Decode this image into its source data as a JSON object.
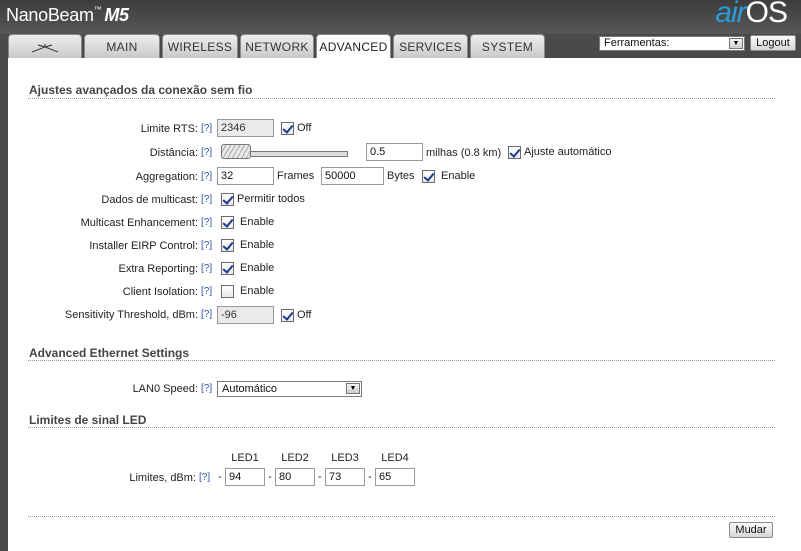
{
  "header": {
    "brand_name": "NanoBeam",
    "brand_tm": "™",
    "brand_model": "M5",
    "logo_air": "air",
    "logo_os": "OS"
  },
  "tabs": [
    {
      "label": "",
      "icon": "ubiquiti-logo-icon"
    },
    {
      "label": "MAIN"
    },
    {
      "label": "WIRELESS"
    },
    {
      "label": "NETWORK"
    },
    {
      "label": "ADVANCED",
      "active": true
    },
    {
      "label": "SERVICES"
    },
    {
      "label": "SYSTEM"
    }
  ],
  "tools": {
    "selected": "Ferramentas:",
    "logout": "Logout"
  },
  "help_label": "[?]",
  "wireless_section": {
    "title": "Ajustes avançados da conexão sem fio",
    "rts": {
      "label": "Limite RTS:",
      "value": "2346",
      "checkbox_label": "Off",
      "checked": true
    },
    "distance": {
      "label": "Distância:",
      "value": "0.5",
      "unit_text": "milhas (0.8 km)",
      "auto_label": "Ajuste automático",
      "auto_checked": true
    },
    "aggregation": {
      "label": "Aggregation:",
      "frames": "32",
      "frames_label": "Frames",
      "bytes": "50000",
      "bytes_label": "Bytes",
      "enable_label": "Enable",
      "checked": true
    },
    "multicast": {
      "label": "Dados de multicast:",
      "checkbox_label": "Permitir todos",
      "checked": true
    },
    "multicast_enh": {
      "label": "Multicast Enhancement:",
      "checkbox_label": "Enable",
      "checked": true
    },
    "eirp": {
      "label": "Installer EIRP Control:",
      "checkbox_label": "Enable",
      "checked": true
    },
    "extra": {
      "label": "Extra Reporting:",
      "checkbox_label": "Enable",
      "checked": true
    },
    "isolation": {
      "label": "Client Isolation:",
      "checkbox_label": "Enable",
      "checked": false
    },
    "sensitivity": {
      "label": "Sensitivity Threshold, dBm:",
      "value": "-96",
      "checkbox_label": "Off",
      "checked": true
    }
  },
  "ethernet_section": {
    "title": "Advanced Ethernet Settings",
    "lan_label": "LAN0 Speed:",
    "lan_value": "Automático"
  },
  "led_section": {
    "title": "Limites de sinal LED",
    "headers": [
      "LED1",
      "LED2",
      "LED3",
      "LED4"
    ],
    "label": "Limites, dBm:",
    "separator": "-",
    "values": [
      "94",
      "80",
      "73",
      "65"
    ]
  },
  "submit_label": "Mudar"
}
